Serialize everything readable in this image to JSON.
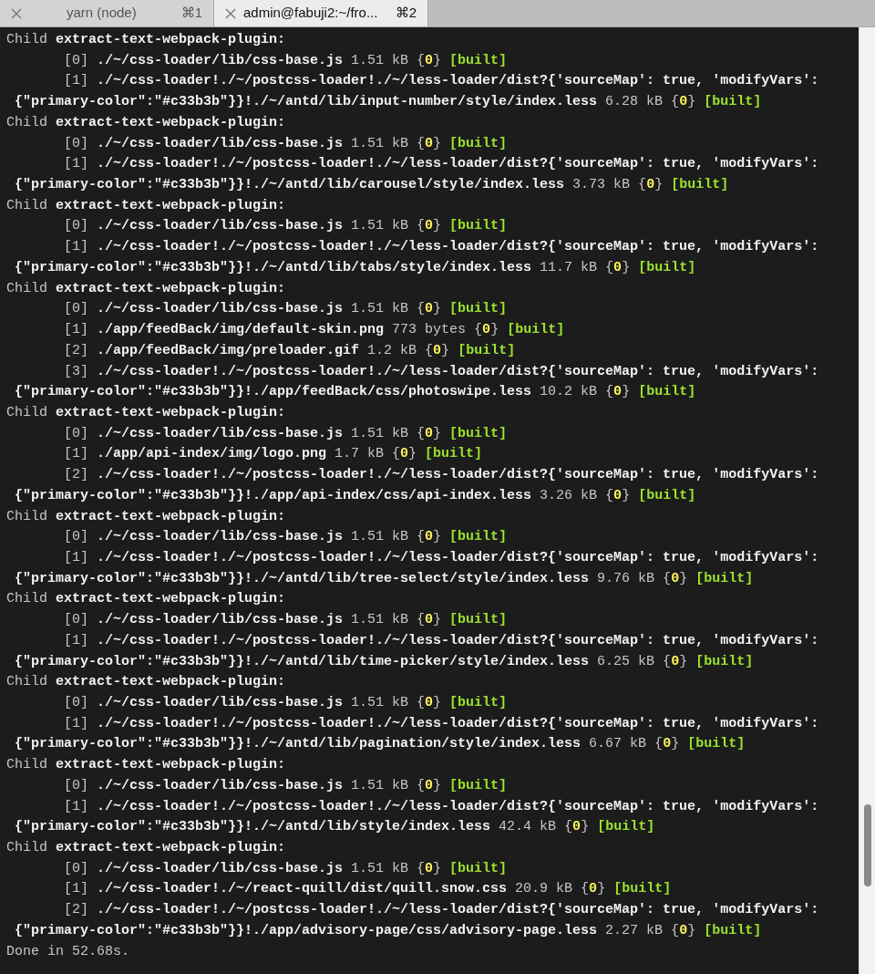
{
  "tabs": [
    {
      "title": "yarn (node)",
      "shortcut": "⌘1",
      "selected": false
    },
    {
      "title": "admin@fabuji2:~/fro...",
      "shortcut": "⌘2",
      "selected": true
    }
  ],
  "terminal": {
    "lines": [
      {
        "kind": "header",
        "segments": [
          {
            "kind": "plain",
            "text": "Child "
          },
          {
            "kind": "bold",
            "text": "extract-text-webpack-plugin:"
          }
        ]
      },
      {
        "kind": "module",
        "segments": [
          {
            "kind": "plain",
            "text": "[0] "
          },
          {
            "kind": "bold",
            "text": "./~/css-loader/lib/css-base.js "
          },
          {
            "kind": "plain",
            "text": "1.51 kB {"
          },
          {
            "kind": "yellow",
            "text": "0"
          },
          {
            "kind": "plain",
            "text": "} "
          },
          {
            "kind": "green",
            "text": "[built]"
          }
        ]
      },
      {
        "kind": "module",
        "segments": [
          {
            "kind": "plain",
            "text": "[1] "
          },
          {
            "kind": "bold",
            "text": "./~/css-loader!./~/postcss-loader!./~/less-loader/dist?{'sourceMap': true, 'modifyVars':"
          }
        ]
      },
      {
        "kind": "continuation",
        "segments": [
          {
            "kind": "bold",
            "text": "{\"primary-color\":\"#c33b3b\"}}!./~/antd/lib/input-number/style/index.less "
          },
          {
            "kind": "plain",
            "text": "6.28 kB {"
          },
          {
            "kind": "yellow",
            "text": "0"
          },
          {
            "kind": "plain",
            "text": "} "
          },
          {
            "kind": "green",
            "text": "[built]"
          }
        ]
      },
      {
        "kind": "header",
        "segments": [
          {
            "kind": "plain",
            "text": "Child "
          },
          {
            "kind": "bold",
            "text": "extract-text-webpack-plugin:"
          }
        ]
      },
      {
        "kind": "module",
        "segments": [
          {
            "kind": "plain",
            "text": "[0] "
          },
          {
            "kind": "bold",
            "text": "./~/css-loader/lib/css-base.js "
          },
          {
            "kind": "plain",
            "text": "1.51 kB {"
          },
          {
            "kind": "yellow",
            "text": "0"
          },
          {
            "kind": "plain",
            "text": "} "
          },
          {
            "kind": "green",
            "text": "[built]"
          }
        ]
      },
      {
        "kind": "module",
        "segments": [
          {
            "kind": "plain",
            "text": "[1] "
          },
          {
            "kind": "bold",
            "text": "./~/css-loader!./~/postcss-loader!./~/less-loader/dist?{'sourceMap': true, 'modifyVars':"
          }
        ]
      },
      {
        "kind": "continuation",
        "segments": [
          {
            "kind": "bold",
            "text": "{\"primary-color\":\"#c33b3b\"}}!./~/antd/lib/carousel/style/index.less "
          },
          {
            "kind": "plain",
            "text": "3.73 kB {"
          },
          {
            "kind": "yellow",
            "text": "0"
          },
          {
            "kind": "plain",
            "text": "} "
          },
          {
            "kind": "green",
            "text": "[built]"
          }
        ]
      },
      {
        "kind": "header",
        "segments": [
          {
            "kind": "plain",
            "text": "Child "
          },
          {
            "kind": "bold",
            "text": "extract-text-webpack-plugin:"
          }
        ]
      },
      {
        "kind": "module",
        "segments": [
          {
            "kind": "plain",
            "text": "[0] "
          },
          {
            "kind": "bold",
            "text": "./~/css-loader/lib/css-base.js "
          },
          {
            "kind": "plain",
            "text": "1.51 kB {"
          },
          {
            "kind": "yellow",
            "text": "0"
          },
          {
            "kind": "plain",
            "text": "} "
          },
          {
            "kind": "green",
            "text": "[built]"
          }
        ]
      },
      {
        "kind": "module",
        "segments": [
          {
            "kind": "plain",
            "text": "[1] "
          },
          {
            "kind": "bold",
            "text": "./~/css-loader!./~/postcss-loader!./~/less-loader/dist?{'sourceMap': true, 'modifyVars':"
          }
        ]
      },
      {
        "kind": "continuation",
        "segments": [
          {
            "kind": "bold",
            "text": "{\"primary-color\":\"#c33b3b\"}}!./~/antd/lib/tabs/style/index.less "
          },
          {
            "kind": "plain",
            "text": "11.7 kB {"
          },
          {
            "kind": "yellow",
            "text": "0"
          },
          {
            "kind": "plain",
            "text": "} "
          },
          {
            "kind": "green",
            "text": "[built]"
          }
        ]
      },
      {
        "kind": "header",
        "segments": [
          {
            "kind": "plain",
            "text": "Child "
          },
          {
            "kind": "bold",
            "text": "extract-text-webpack-plugin:"
          }
        ]
      },
      {
        "kind": "module",
        "segments": [
          {
            "kind": "plain",
            "text": "[0] "
          },
          {
            "kind": "bold",
            "text": "./~/css-loader/lib/css-base.js "
          },
          {
            "kind": "plain",
            "text": "1.51 kB {"
          },
          {
            "kind": "yellow",
            "text": "0"
          },
          {
            "kind": "plain",
            "text": "} "
          },
          {
            "kind": "green",
            "text": "[built]"
          }
        ]
      },
      {
        "kind": "module",
        "segments": [
          {
            "kind": "plain",
            "text": "[1] "
          },
          {
            "kind": "bold",
            "text": "./app/feedBack/img/default-skin.png "
          },
          {
            "kind": "plain",
            "text": "773 bytes {"
          },
          {
            "kind": "yellow",
            "text": "0"
          },
          {
            "kind": "plain",
            "text": "} "
          },
          {
            "kind": "green",
            "text": "[built]"
          }
        ]
      },
      {
        "kind": "module",
        "segments": [
          {
            "kind": "plain",
            "text": "[2] "
          },
          {
            "kind": "bold",
            "text": "./app/feedBack/img/preloader.gif "
          },
          {
            "kind": "plain",
            "text": "1.2 kB {"
          },
          {
            "kind": "yellow",
            "text": "0"
          },
          {
            "kind": "plain",
            "text": "} "
          },
          {
            "kind": "green",
            "text": "[built]"
          }
        ]
      },
      {
        "kind": "module",
        "segments": [
          {
            "kind": "plain",
            "text": "[3] "
          },
          {
            "kind": "bold",
            "text": "./~/css-loader!./~/postcss-loader!./~/less-loader/dist?{'sourceMap': true, 'modifyVars':"
          }
        ]
      },
      {
        "kind": "continuation",
        "segments": [
          {
            "kind": "bold",
            "text": "{\"primary-color\":\"#c33b3b\"}}!./app/feedBack/css/photoswipe.less "
          },
          {
            "kind": "plain",
            "text": "10.2 kB {"
          },
          {
            "kind": "yellow",
            "text": "0"
          },
          {
            "kind": "plain",
            "text": "} "
          },
          {
            "kind": "green",
            "text": "[built]"
          }
        ]
      },
      {
        "kind": "header",
        "segments": [
          {
            "kind": "plain",
            "text": "Child "
          },
          {
            "kind": "bold",
            "text": "extract-text-webpack-plugin:"
          }
        ]
      },
      {
        "kind": "module",
        "segments": [
          {
            "kind": "plain",
            "text": "[0] "
          },
          {
            "kind": "bold",
            "text": "./~/css-loader/lib/css-base.js "
          },
          {
            "kind": "plain",
            "text": "1.51 kB {"
          },
          {
            "kind": "yellow",
            "text": "0"
          },
          {
            "kind": "plain",
            "text": "} "
          },
          {
            "kind": "green",
            "text": "[built]"
          }
        ]
      },
      {
        "kind": "module",
        "segments": [
          {
            "kind": "plain",
            "text": "[1] "
          },
          {
            "kind": "bold",
            "text": "./app/api-index/img/logo.png "
          },
          {
            "kind": "plain",
            "text": "1.7 kB {"
          },
          {
            "kind": "yellow",
            "text": "0"
          },
          {
            "kind": "plain",
            "text": "} "
          },
          {
            "kind": "green",
            "text": "[built]"
          }
        ]
      },
      {
        "kind": "module",
        "segments": [
          {
            "kind": "plain",
            "text": "[2] "
          },
          {
            "kind": "bold",
            "text": "./~/css-loader!./~/postcss-loader!./~/less-loader/dist?{'sourceMap': true, 'modifyVars':"
          }
        ]
      },
      {
        "kind": "continuation",
        "segments": [
          {
            "kind": "bold",
            "text": "{\"primary-color\":\"#c33b3b\"}}!./app/api-index/css/api-index.less "
          },
          {
            "kind": "plain",
            "text": "3.26 kB {"
          },
          {
            "kind": "yellow",
            "text": "0"
          },
          {
            "kind": "plain",
            "text": "} "
          },
          {
            "kind": "green",
            "text": "[built]"
          }
        ]
      },
      {
        "kind": "header",
        "segments": [
          {
            "kind": "plain",
            "text": "Child "
          },
          {
            "kind": "bold",
            "text": "extract-text-webpack-plugin:"
          }
        ]
      },
      {
        "kind": "module",
        "segments": [
          {
            "kind": "plain",
            "text": "[0] "
          },
          {
            "kind": "bold",
            "text": "./~/css-loader/lib/css-base.js "
          },
          {
            "kind": "plain",
            "text": "1.51 kB {"
          },
          {
            "kind": "yellow",
            "text": "0"
          },
          {
            "kind": "plain",
            "text": "} "
          },
          {
            "kind": "green",
            "text": "[built]"
          }
        ]
      },
      {
        "kind": "module",
        "segments": [
          {
            "kind": "plain",
            "text": "[1] "
          },
          {
            "kind": "bold",
            "text": "./~/css-loader!./~/postcss-loader!./~/less-loader/dist?{'sourceMap': true, 'modifyVars':"
          }
        ]
      },
      {
        "kind": "continuation",
        "segments": [
          {
            "kind": "bold",
            "text": "{\"primary-color\":\"#c33b3b\"}}!./~/antd/lib/tree-select/style/index.less "
          },
          {
            "kind": "plain",
            "text": "9.76 kB {"
          },
          {
            "kind": "yellow",
            "text": "0"
          },
          {
            "kind": "plain",
            "text": "} "
          },
          {
            "kind": "green",
            "text": "[built]"
          }
        ]
      },
      {
        "kind": "header",
        "segments": [
          {
            "kind": "plain",
            "text": "Child "
          },
          {
            "kind": "bold",
            "text": "extract-text-webpack-plugin:"
          }
        ]
      },
      {
        "kind": "module",
        "segments": [
          {
            "kind": "plain",
            "text": "[0] "
          },
          {
            "kind": "bold",
            "text": "./~/css-loader/lib/css-base.js "
          },
          {
            "kind": "plain",
            "text": "1.51 kB {"
          },
          {
            "kind": "yellow",
            "text": "0"
          },
          {
            "kind": "plain",
            "text": "} "
          },
          {
            "kind": "green",
            "text": "[built]"
          }
        ]
      },
      {
        "kind": "module",
        "segments": [
          {
            "kind": "plain",
            "text": "[1] "
          },
          {
            "kind": "bold",
            "text": "./~/css-loader!./~/postcss-loader!./~/less-loader/dist?{'sourceMap': true, 'modifyVars':"
          }
        ]
      },
      {
        "kind": "continuation",
        "segments": [
          {
            "kind": "bold",
            "text": "{\"primary-color\":\"#c33b3b\"}}!./~/antd/lib/time-picker/style/index.less "
          },
          {
            "kind": "plain",
            "text": "6.25 kB {"
          },
          {
            "kind": "yellow",
            "text": "0"
          },
          {
            "kind": "plain",
            "text": "} "
          },
          {
            "kind": "green",
            "text": "[built]"
          }
        ]
      },
      {
        "kind": "header",
        "segments": [
          {
            "kind": "plain",
            "text": "Child "
          },
          {
            "kind": "bold",
            "text": "extract-text-webpack-plugin:"
          }
        ]
      },
      {
        "kind": "module",
        "segments": [
          {
            "kind": "plain",
            "text": "[0] "
          },
          {
            "kind": "bold",
            "text": "./~/css-loader/lib/css-base.js "
          },
          {
            "kind": "plain",
            "text": "1.51 kB {"
          },
          {
            "kind": "yellow",
            "text": "0"
          },
          {
            "kind": "plain",
            "text": "} "
          },
          {
            "kind": "green",
            "text": "[built]"
          }
        ]
      },
      {
        "kind": "module",
        "segments": [
          {
            "kind": "plain",
            "text": "[1] "
          },
          {
            "kind": "bold",
            "text": "./~/css-loader!./~/postcss-loader!./~/less-loader/dist?{'sourceMap': true, 'modifyVars':"
          }
        ]
      },
      {
        "kind": "continuation",
        "segments": [
          {
            "kind": "bold",
            "text": "{\"primary-color\":\"#c33b3b\"}}!./~/antd/lib/pagination/style/index.less "
          },
          {
            "kind": "plain",
            "text": "6.67 kB {"
          },
          {
            "kind": "yellow",
            "text": "0"
          },
          {
            "kind": "plain",
            "text": "} "
          },
          {
            "kind": "green",
            "text": "[built]"
          }
        ]
      },
      {
        "kind": "header",
        "segments": [
          {
            "kind": "plain",
            "text": "Child "
          },
          {
            "kind": "bold",
            "text": "extract-text-webpack-plugin:"
          }
        ]
      },
      {
        "kind": "module",
        "segments": [
          {
            "kind": "plain",
            "text": "[0] "
          },
          {
            "kind": "bold",
            "text": "./~/css-loader/lib/css-base.js "
          },
          {
            "kind": "plain",
            "text": "1.51 kB {"
          },
          {
            "kind": "yellow",
            "text": "0"
          },
          {
            "kind": "plain",
            "text": "} "
          },
          {
            "kind": "green",
            "text": "[built]"
          }
        ]
      },
      {
        "kind": "module",
        "segments": [
          {
            "kind": "plain",
            "text": "[1] "
          },
          {
            "kind": "bold",
            "text": "./~/css-loader!./~/postcss-loader!./~/less-loader/dist?{'sourceMap': true, 'modifyVars':"
          }
        ]
      },
      {
        "kind": "continuation",
        "segments": [
          {
            "kind": "bold",
            "text": "{\"primary-color\":\"#c33b3b\"}}!./~/antd/lib/style/index.less "
          },
          {
            "kind": "plain",
            "text": "42.4 kB {"
          },
          {
            "kind": "yellow",
            "text": "0"
          },
          {
            "kind": "plain",
            "text": "} "
          },
          {
            "kind": "green",
            "text": "[built]"
          }
        ]
      },
      {
        "kind": "header",
        "segments": [
          {
            "kind": "plain",
            "text": "Child "
          },
          {
            "kind": "bold",
            "text": "extract-text-webpack-plugin:"
          }
        ]
      },
      {
        "kind": "module",
        "segments": [
          {
            "kind": "plain",
            "text": "[0] "
          },
          {
            "kind": "bold",
            "text": "./~/css-loader/lib/css-base.js "
          },
          {
            "kind": "plain",
            "text": "1.51 kB {"
          },
          {
            "kind": "yellow",
            "text": "0"
          },
          {
            "kind": "plain",
            "text": "} "
          },
          {
            "kind": "green",
            "text": "[built]"
          }
        ]
      },
      {
        "kind": "module",
        "segments": [
          {
            "kind": "plain",
            "text": "[1] "
          },
          {
            "kind": "bold",
            "text": "./~/css-loader!./~/react-quill/dist/quill.snow.css "
          },
          {
            "kind": "plain",
            "text": "20.9 kB {"
          },
          {
            "kind": "yellow",
            "text": "0"
          },
          {
            "kind": "plain",
            "text": "} "
          },
          {
            "kind": "green",
            "text": "[built]"
          }
        ]
      },
      {
        "kind": "module",
        "segments": [
          {
            "kind": "plain",
            "text": "[2] "
          },
          {
            "kind": "bold",
            "text": "./~/css-loader!./~/postcss-loader!./~/less-loader/dist?{'sourceMap': true, 'modifyVars':"
          }
        ]
      },
      {
        "kind": "continuation",
        "segments": [
          {
            "kind": "bold",
            "text": "{\"primary-color\":\"#c33b3b\"}}!./app/advisory-page/css/advisory-page.less "
          },
          {
            "kind": "plain",
            "text": "2.27 kB {"
          },
          {
            "kind": "yellow",
            "text": "0"
          },
          {
            "kind": "plain",
            "text": "} "
          },
          {
            "kind": "green",
            "text": "[built]"
          }
        ]
      },
      {
        "kind": "header",
        "segments": [
          {
            "kind": "plain",
            "text": "Done in 52.68s."
          }
        ]
      }
    ]
  }
}
